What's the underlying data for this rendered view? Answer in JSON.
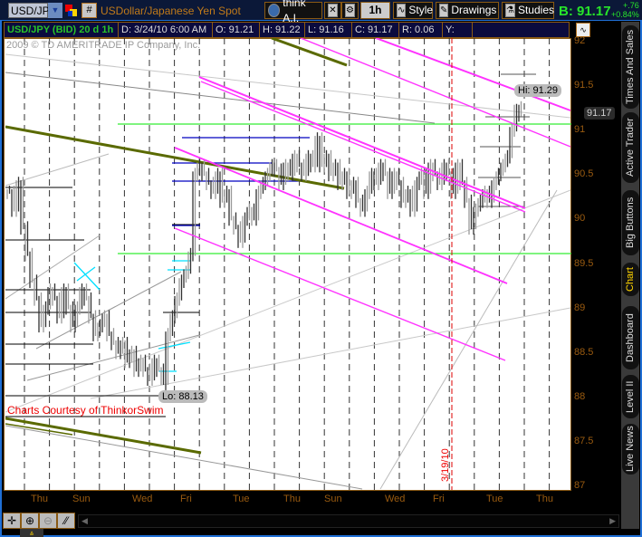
{
  "header": {
    "symbol": "USD/JPY",
    "description": "USDollar/Japanese Yen Spot",
    "hash_label": "#",
    "think_ai": "think A.I.",
    "interval": "1h",
    "style": "Style",
    "drawings": "Drawings",
    "studies": "Studies",
    "bid": "B: 91.17",
    "change": "+.76",
    "change_pct": "+0.84%"
  },
  "info": {
    "title": "USD/JPY (BID) 20 d 1h",
    "date": "D: 3/24/10 6:00 AM",
    "open": "O: 91.21",
    "high": "H: 91.22",
    "low": "L: 91.16",
    "close": "C: 91.17",
    "range": "R: 0.06",
    "y": "Y:"
  },
  "chart": {
    "copyright": "2009 © TD AMERITRADE IP Company, Inc.",
    "courtesy": "Charts Courtesy of ThinkorSwim",
    "hi_label": "Hi: 91.29",
    "lo_label": "Lo: 88.13",
    "date_marker": "3/19/10",
    "current_price": "91.17",
    "colors": {
      "channel": "#ff33ff",
      "support": "#33ee33",
      "olive": "#5a6a00",
      "blue": "#0000c0",
      "marker": "#dd0000"
    }
  },
  "chart_data": {
    "type": "line",
    "title": "USD/JPY (BID) 20 d 1h",
    "ylim": [
      87,
      92
    ],
    "yticks": [
      "92",
      "91.5",
      "91",
      "90.5",
      "90",
      "89.5",
      "89",
      "88.5",
      "88",
      "87.5",
      "87"
    ],
    "xticks": [
      "Thu",
      "Sun",
      "Wed",
      "Fri",
      "Tue",
      "Thu",
      "Sun",
      "Wed",
      "Fri",
      "Tue",
      "Thu"
    ],
    "high": 91.29,
    "low": 88.13,
    "closes": [
      90.3,
      90.1,
      90.4,
      89.9,
      89.6,
      89.3,
      89.1,
      88.8,
      89.0,
      89.2,
      89.1,
      88.9,
      89.2,
      89.0,
      88.8,
      89.0,
      89.2,
      89.1,
      88.9,
      88.7,
      88.8,
      88.9,
      88.7,
      88.6,
      88.5,
      88.6,
      88.4,
      88.5,
      88.3,
      88.4,
      88.3,
      88.2,
      88.4,
      88.3,
      88.15,
      88.7,
      88.9,
      89.1,
      89.3,
      89.4,
      89.6,
      90.5,
      90.6,
      90.5,
      90.4,
      90.3,
      90.5,
      90.2,
      90.3,
      90.0,
      89.9,
      89.75,
      90.0,
      90.1,
      90.0,
      90.3,
      90.4,
      90.5,
      90.6,
      90.55,
      90.4,
      90.6,
      90.5,
      90.7,
      90.6,
      90.5,
      90.7,
      90.6,
      90.9,
      90.6,
      90.7,
      90.5,
      90.6,
      90.4,
      90.5,
      90.3,
      90.4,
      90.2,
      90.1,
      90.3,
      90.5,
      90.4,
      90.6,
      90.5,
      90.3,
      90.5,
      90.4,
      90.2,
      90.3,
      90.1,
      90.4,
      90.5,
      90.3,
      90.6,
      90.5,
      90.4,
      90.6,
      90.5,
      90.3,
      90.6,
      90.4,
      90.2,
      89.9,
      90.1,
      90.2,
      90.3,
      90.2,
      90.4,
      90.5,
      90.6,
      90.7,
      91.0,
      91.25,
      91.17
    ]
  },
  "side_tabs": [
    "Times And Sales",
    "Active Trader",
    "Big Buttons",
    "Chart",
    "Dashboard",
    "Level II",
    "Live News"
  ]
}
